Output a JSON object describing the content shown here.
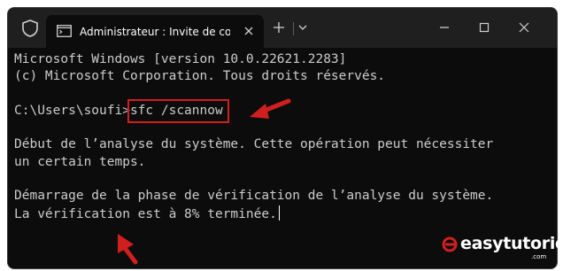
{
  "window": {
    "tab_title": "Administrateur : Invite de con",
    "icons": {
      "shield": "shield-icon",
      "terminal": "terminal-icon",
      "close_tab": "close-icon",
      "new_tab": "plus-icon",
      "dropdown": "chevron-down-icon",
      "minimize": "minimize-icon",
      "maximize": "maximize-icon",
      "close": "close-icon"
    }
  },
  "console": {
    "line1": "Microsoft Windows [version 10.0.22621.2283]",
    "line2": "(c) Microsoft Corporation. Tous droits réservés.",
    "prompt": "C:\\Users\\soufi",
    "prompt_char": ">",
    "command": "sfc /scannow",
    "line4a": "Début de l’analyse du système. Cette opération peut nécessiter",
    "line4b": "un certain temps.",
    "line5a": "Démarrage de la phase de vérification de l’analyse du système.",
    "line5b": "La vérification est à 8% terminée."
  },
  "annotation": {
    "highlight_color": "#d11f1f"
  },
  "watermark": {
    "text": "easytutoriel",
    "suffix": ".com"
  },
  "colors": {
    "console_bg": "#0c0c0c",
    "titlebar_bg": "#1f1f1f",
    "text": "#cccccc",
    "accent_red": "#d11f1f"
  }
}
